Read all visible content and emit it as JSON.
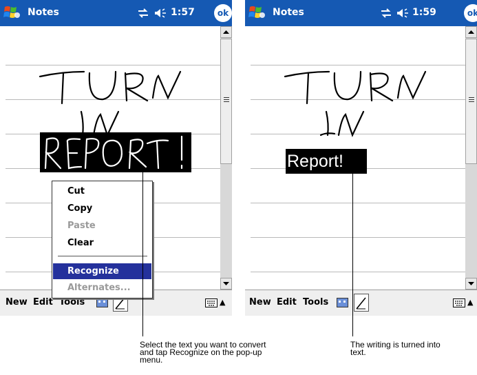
{
  "left_screen": {
    "title": "Notes",
    "time": "1:57",
    "ok_label": "ok",
    "ink_lines": [
      "TURN",
      "IN",
      "REPORT!"
    ],
    "selected_ink": "REPORT!",
    "context_menu": {
      "items": [
        {
          "label": "Cut",
          "state": "enabled"
        },
        {
          "label": "Copy",
          "state": "enabled"
        },
        {
          "label": "Paste",
          "state": "disabled"
        },
        {
          "label": "Clear",
          "state": "enabled"
        },
        {
          "label": "Recognize",
          "state": "selected"
        },
        {
          "label": "Alternates...",
          "state": "disabled"
        }
      ]
    },
    "command_bar": {
      "new": "New",
      "edit": "Edit",
      "tools": "Tools"
    },
    "icons": [
      "windows-flag-icon",
      "connectivity-icon",
      "speaker-icon",
      "recording-icon",
      "pen-icon",
      "keyboard-icon",
      "sip-up-arrow-icon",
      "scroll-up-icon",
      "scroll-down-icon"
    ]
  },
  "right_screen": {
    "title": "Notes",
    "time": "1:59",
    "ok_label": "ok",
    "ink_lines": [
      "TURN",
      "IN"
    ],
    "recognized_text": "Report!",
    "command_bar": {
      "new": "New",
      "edit": "Edit",
      "tools": "Tools"
    }
  },
  "captions": {
    "left": [
      "Select the text you want to convert",
      "and tap Recognize on the pop-up",
      "menu."
    ],
    "right": [
      "The writing is turned into",
      "text."
    ]
  },
  "colors": {
    "title_bar": "#1559b3",
    "menu_selected": "#24319c",
    "selection": "#000000",
    "command_bar": "#efefef"
  }
}
